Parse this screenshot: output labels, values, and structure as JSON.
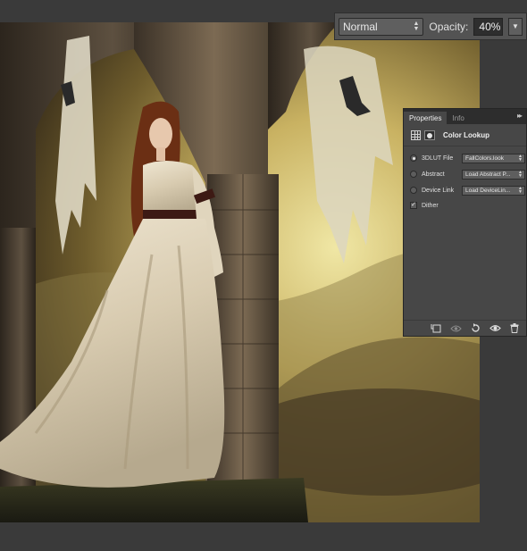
{
  "toolbar": {
    "blend_mode": "Normal",
    "opacity_label": "Opacity:",
    "opacity_value": "40%"
  },
  "panel": {
    "tabs": [
      {
        "label": "Properties",
        "active": true
      },
      {
        "label": "Info",
        "active": false
      }
    ],
    "title": "Color Lookup",
    "rows": [
      {
        "label": "3DLUT File",
        "value": "FallColors.look",
        "selected": true
      },
      {
        "label": "Abstract",
        "value": "Load Abstract P...",
        "selected": false
      },
      {
        "label": "Device Link",
        "value": "Load DeviceLin...",
        "selected": false
      }
    ],
    "dither": {
      "label": "Dither",
      "checked": true
    },
    "footer_icons": [
      "clip-to-layer-icon",
      "view-previous-state-icon",
      "reset-icon",
      "visibility-eye-icon",
      "trash-icon"
    ]
  },
  "colors": {
    "workspace": "#3a3a3a",
    "panel_bg": "#474747",
    "tab_bar": "#2d2d2d",
    "text": "#e0e0e0"
  }
}
